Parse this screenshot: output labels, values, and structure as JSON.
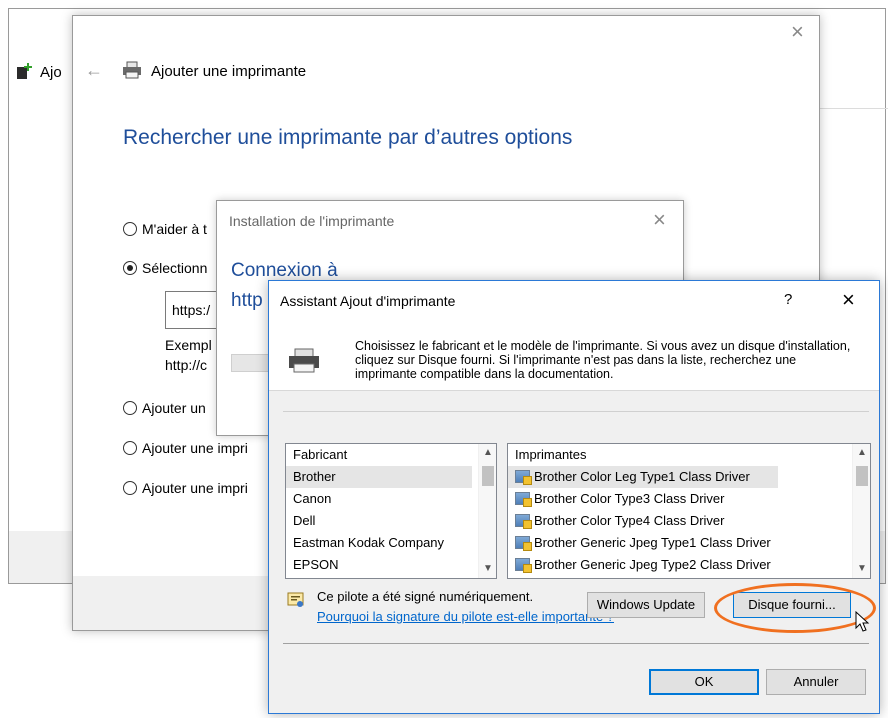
{
  "background_window": {
    "title": "Ajo"
  },
  "wizard": {
    "title": "Ajouter une imprimante",
    "heading": "Rechercher une imprimante par d’autres options",
    "options": [
      {
        "label": "M'aider à t",
        "checked": false
      },
      {
        "label": "Sélectionn",
        "checked": true
      },
      {
        "label": "Ajouter un",
        "checked": false
      },
      {
        "label": "Ajouter une impri",
        "checked": false
      },
      {
        "label": "Ajouter une impri",
        "checked": false
      }
    ],
    "url_value": "https:/",
    "example_line1": "Exempl",
    "example_line2": "http://c"
  },
  "installation": {
    "title": "Installation de l'imprimante",
    "heading_line1": "Connexion à",
    "heading_line2": "http"
  },
  "assistant": {
    "title": "Assistant Ajout d'imprimante",
    "help_label": "?",
    "description": "Choisissez le fabricant et le modèle de l'imprimante. Si vous avez un disque d'installation, cliquez sur Disque fourni. Si l'imprimante n'est pas dans la liste, recherchez une imprimante compatible dans la documentation.",
    "manufacturer_header": "Fabricant",
    "manufacturers": [
      "Brother",
      "Canon",
      "Dell",
      "Eastman Kodak Company",
      "EPSON"
    ],
    "printer_header": "Imprimantes",
    "printers": [
      "Brother Color Leg Type1 Class Driver",
      "Brother Color Type3 Class Driver",
      "Brother Color Type4 Class Driver",
      "Brother Generic Jpeg Type1 Class Driver",
      "Brother Generic Jpeg Type2 Class Driver"
    ],
    "signed_text": "Ce pilote a été signé numériquement.",
    "signature_link": "Pourquoi la signature du pilote est-elle importante ?",
    "windows_update_label": "Windows Update",
    "have_disk_label": "Disque fourni...",
    "ok_label": "OK",
    "cancel_label": "Annuler"
  },
  "colors": {
    "heading_blue": "#1f4e9a",
    "highlight_orange": "#f07020",
    "focus_blue": "#0078d7"
  }
}
